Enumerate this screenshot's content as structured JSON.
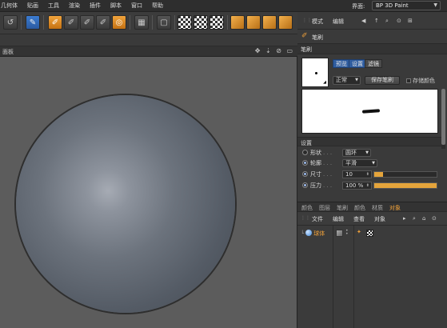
{
  "menubar": {
    "items": [
      "几何体",
      "贴画",
      "工具",
      "渲染",
      "插件",
      "脚本",
      "窗口",
      "帮助"
    ],
    "ui_label": "界面:",
    "layout_value": "BP 3D Paint"
  },
  "viewport": {
    "title": "面板",
    "nav_icons": "✥ ⇣ ⊘ ▭"
  },
  "right_panel": {
    "mode_menu": "模式",
    "edit_menu": "编辑",
    "brush_title": "笔刷",
    "brush_section": "笔刷",
    "tabs": [
      "预览",
      "设置",
      "滤镜"
    ],
    "mode_value": "正常",
    "save_brush": "保存笔刷",
    "store_color": "存储颜色",
    "settings_section": "设置",
    "settings": {
      "shape_label": "形状",
      "shape_value": "圆环",
      "contour_label": "轮廓",
      "contour_value": "平滑",
      "size_label": "尺寸",
      "size_value": "10",
      "pressure_label": "压力",
      "pressure_value": "100 %",
      "size_fraction": 0.14,
      "pressure_fraction": 1.0
    },
    "om_tabs": [
      "颜色",
      "图层",
      "笔刷",
      "颜色",
      "材质",
      "对象"
    ],
    "om_menu": [
      "文件",
      "编辑",
      "查看",
      "对象"
    ],
    "object_name": "球体"
  },
  "colors": {
    "accent": "#f0a13a",
    "active_blue": "#2f5da0",
    "viewport_bg": "#5c5c5c"
  }
}
